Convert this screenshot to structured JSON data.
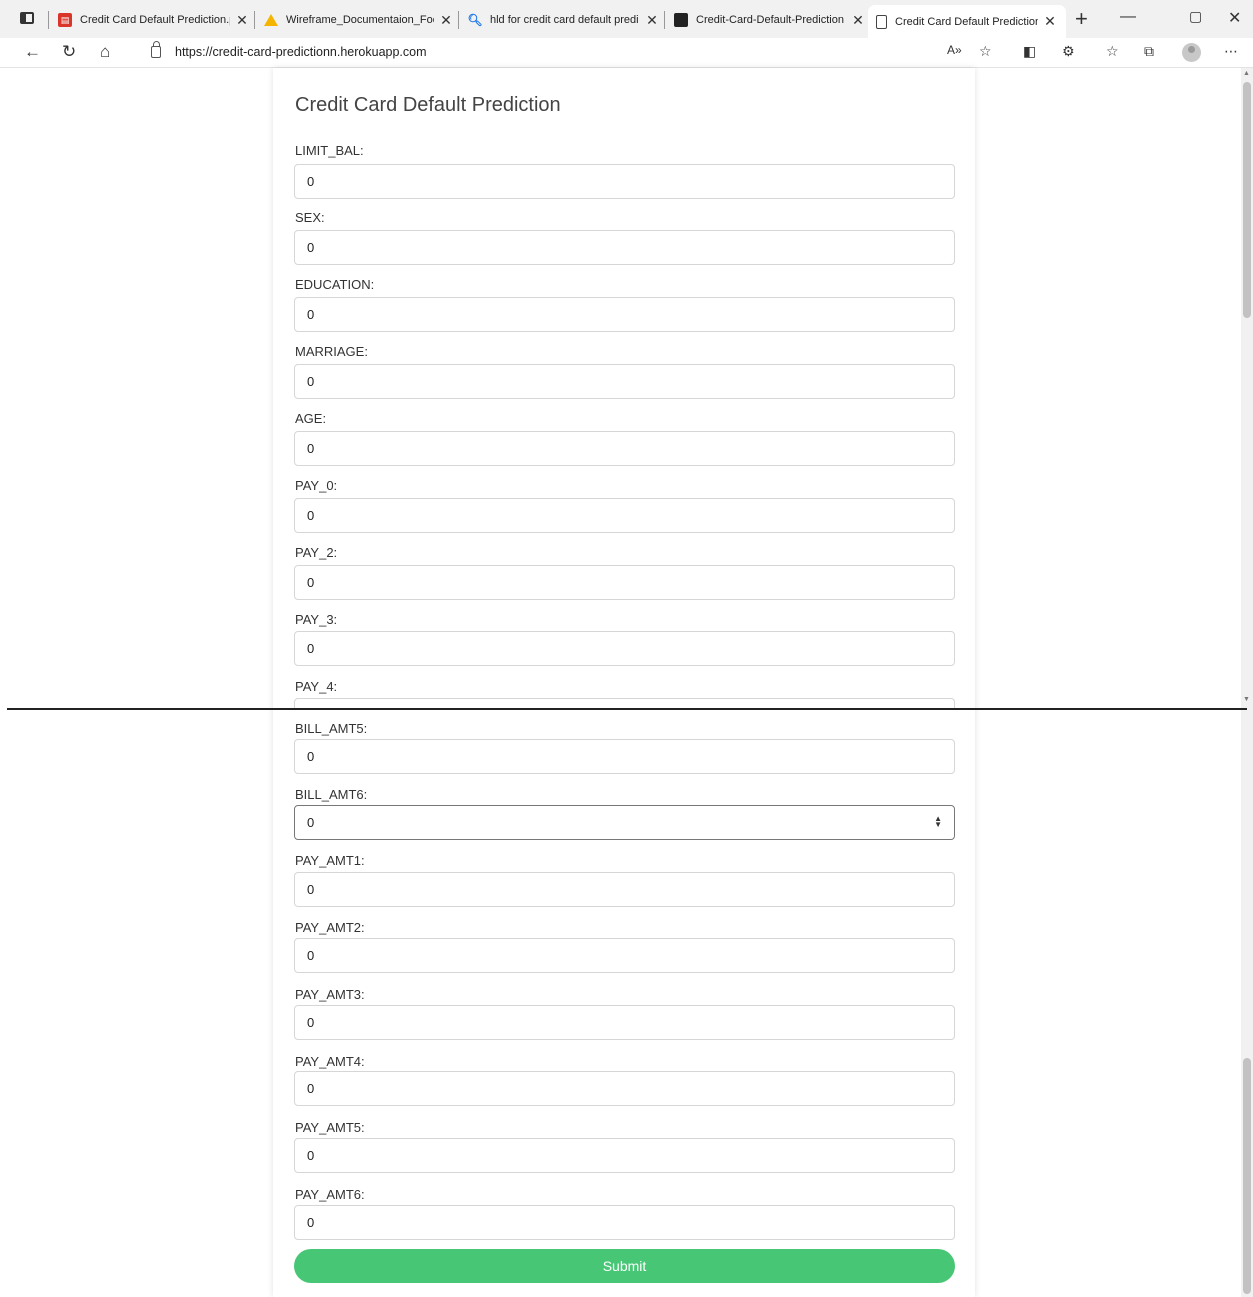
{
  "browser": {
    "tabs": [
      {
        "title": "Credit Card Default Prediction.p",
        "icon": "pdf-icon"
      },
      {
        "title": "Wireframe_Documentaion_Food",
        "icon": "google-drive-icon"
      },
      {
        "title": "hld for credit card default predi",
        "icon": "search-icon"
      },
      {
        "title": "Credit-Card-Default-Prediction",
        "icon": "github-icon"
      },
      {
        "title": "Credit Card Default Prediction",
        "icon": "page-icon",
        "active": true
      }
    ],
    "url": "https://credit-card-predictionn.herokuapp.com"
  },
  "page": {
    "title": "Credit Card Default Prediction",
    "fields_top": [
      {
        "label": "LIMIT_BAL:",
        "value": "0"
      },
      {
        "label": "SEX:",
        "value": "0"
      },
      {
        "label": "EDUCATION:",
        "value": "0"
      },
      {
        "label": "MARRIAGE:",
        "value": "0"
      },
      {
        "label": "AGE:",
        "value": "0"
      },
      {
        "label": "PAY_0:",
        "value": "0"
      },
      {
        "label": "PAY_2:",
        "value": "0"
      },
      {
        "label": "PAY_3:",
        "value": "0"
      },
      {
        "label": "PAY_4:",
        "value": ""
      }
    ],
    "fields_bottom": [
      {
        "label": "BILL_AMT5:",
        "value": "0"
      },
      {
        "label": "BILL_AMT6:",
        "value": "0"
      },
      {
        "label": "PAY_AMT1:",
        "value": "0"
      },
      {
        "label": "PAY_AMT2:",
        "value": "0"
      },
      {
        "label": "PAY_AMT3:",
        "value": "0"
      },
      {
        "label": "PAY_AMT4:",
        "value": "0"
      },
      {
        "label": "PAY_AMT5:",
        "value": "0"
      },
      {
        "label": "PAY_AMT6:",
        "value": "0"
      }
    ],
    "submit_label": "Submit"
  },
  "colors": {
    "submit": "#47c775"
  }
}
